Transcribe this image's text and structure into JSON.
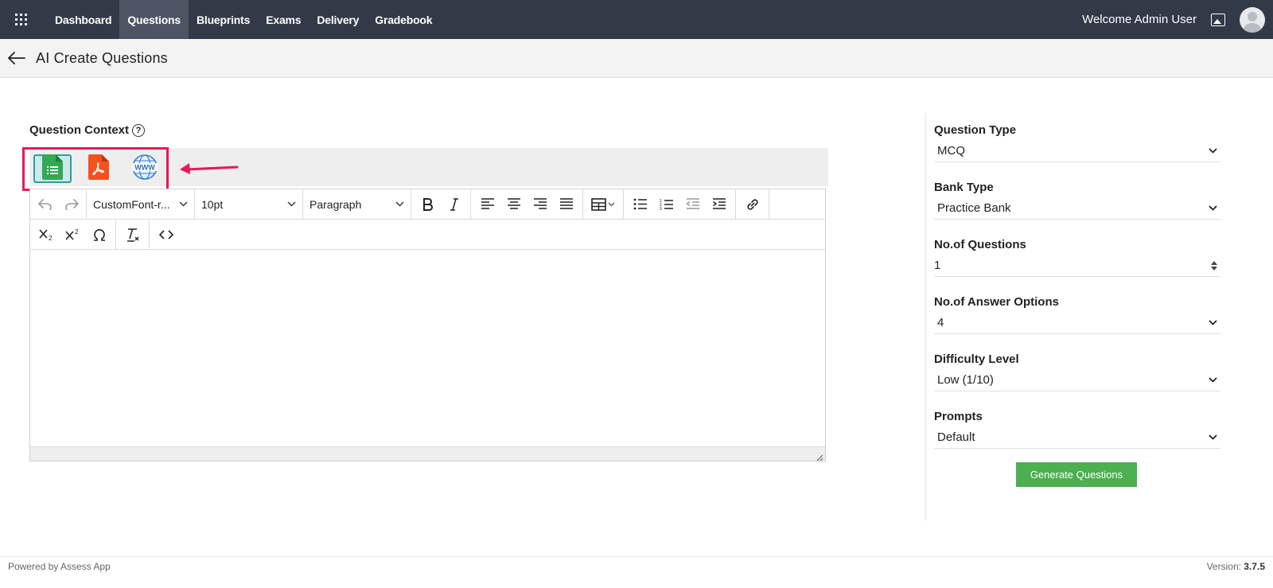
{
  "nav": {
    "items": [
      "Dashboard",
      "Questions",
      "Blueprints",
      "Exams",
      "Delivery",
      "Gradebook"
    ],
    "active": "Questions"
  },
  "header": {
    "welcome": "Welcome Admin User"
  },
  "page": {
    "title": "AI Create Questions"
  },
  "context": {
    "label": "Question Context",
    "help": "?",
    "sources": [
      {
        "name": "document-source-icon",
        "selected": true
      },
      {
        "name": "pdf-source-icon",
        "selected": false
      },
      {
        "name": "website-source-icon",
        "selected": false
      }
    ],
    "www_text": "WWW"
  },
  "editor": {
    "font": "CustomFont-r...",
    "size": "10pt",
    "block": "Paragraph",
    "content": ""
  },
  "form": {
    "question_type": {
      "label": "Question Type",
      "value": "MCQ"
    },
    "bank_type": {
      "label": "Bank Type",
      "value": "Practice Bank"
    },
    "num_questions": {
      "label": "No.of Questions",
      "value": "1"
    },
    "num_options": {
      "label": "No.of Answer Options",
      "value": "4"
    },
    "difficulty": {
      "label": "Difficulty Level",
      "value": "Low (1/10)"
    },
    "prompts": {
      "label": "Prompts",
      "value": "Default"
    },
    "generate_label": "Generate Questions"
  },
  "footer": {
    "powered": "Powered by Assess App",
    "version_label": "Version:",
    "version": "3.7.5"
  },
  "colors": {
    "topbar": "#323a48",
    "accent_green": "#4caf50",
    "highlight": "#e8185a"
  }
}
